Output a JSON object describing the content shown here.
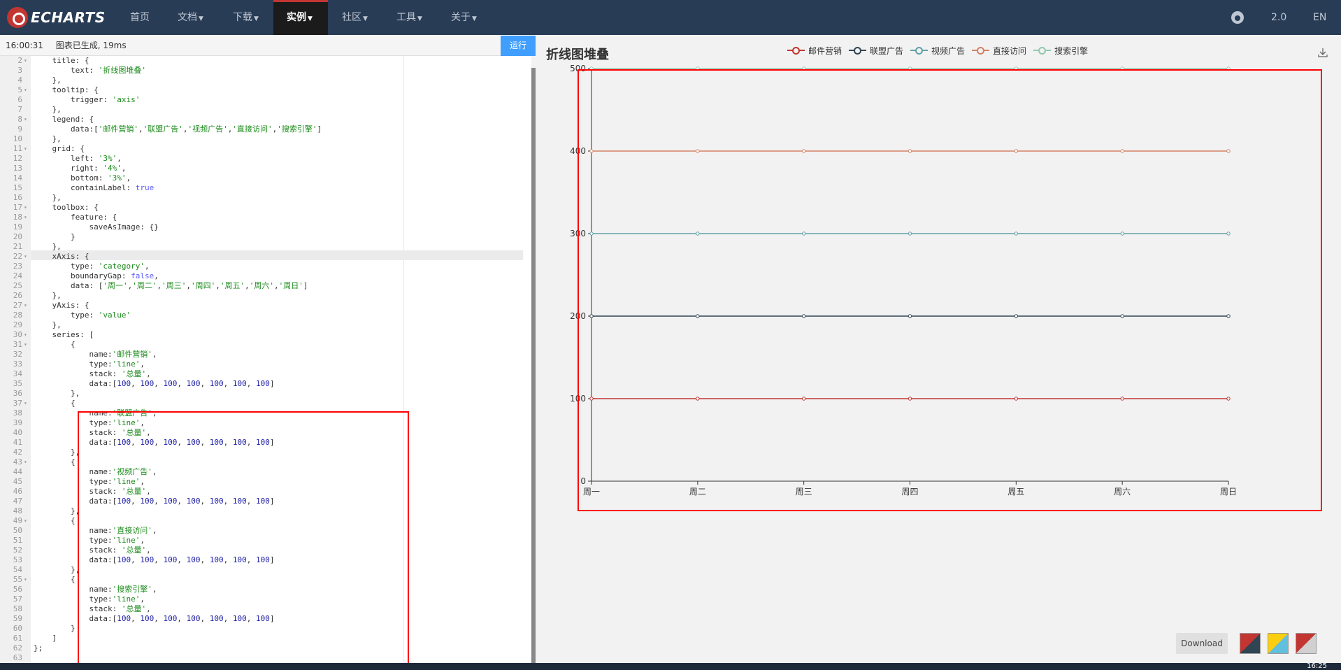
{
  "nav": {
    "logo_text": "ECHARTS",
    "items": [
      "首页",
      "文档",
      "下载",
      "实例",
      "社区",
      "工具",
      "关于"
    ],
    "version": "2.0",
    "language": "EN"
  },
  "editor": {
    "status_time": "16:00:31",
    "status_message": "图表已生成, 19ms",
    "run_label": "运行",
    "lines": [
      {
        "n": "2",
        "fold": "▾",
        "html": "    title: {"
      },
      {
        "n": "3",
        "fold": "",
        "html": "        text: <span class=\"s\">'折线图堆叠'</span>"
      },
      {
        "n": "4",
        "fold": "",
        "html": "    },"
      },
      {
        "n": "5",
        "fold": "▾",
        "html": "    tooltip: {"
      },
      {
        "n": "6",
        "fold": "",
        "html": "        trigger: <span class=\"s\">'axis'</span>"
      },
      {
        "n": "7",
        "fold": "",
        "html": "    },"
      },
      {
        "n": "8",
        "fold": "▾",
        "html": "    legend: {"
      },
      {
        "n": "9",
        "fold": "",
        "html": "        data:[<span class=\"s\">'邮件营销'</span>,<span class=\"s\">'联盟广告'</span>,<span class=\"s\">'视频广告'</span>,<span class=\"s\">'直接访问'</span>,<span class=\"s\">'搜索引擎'</span>]"
      },
      {
        "n": "10",
        "fold": "",
        "html": "    },"
      },
      {
        "n": "11",
        "fold": "▾",
        "html": "    grid: {"
      },
      {
        "n": "12",
        "fold": "",
        "html": "        left: <span class=\"s\">'3%'</span>,"
      },
      {
        "n": "13",
        "fold": "",
        "html": "        right: <span class=\"s\">'4%'</span>,"
      },
      {
        "n": "14",
        "fold": "",
        "html": "        bottom: <span class=\"s\">'3%'</span>,"
      },
      {
        "n": "15",
        "fold": "",
        "html": "        containLabel: <span class=\"b\">true</span>"
      },
      {
        "n": "16",
        "fold": "",
        "html": "    },"
      },
      {
        "n": "17",
        "fold": "▾",
        "html": "    toolbox: {"
      },
      {
        "n": "18",
        "fold": "▾",
        "html": "        feature: {"
      },
      {
        "n": "19",
        "fold": "",
        "html": "            saveAsImage: {}"
      },
      {
        "n": "20",
        "fold": "",
        "html": "        }"
      },
      {
        "n": "21",
        "fold": "",
        "html": "    },"
      },
      {
        "n": "22",
        "fold": "▾",
        "html": "    xAxis: {"
      },
      {
        "n": "23",
        "fold": "",
        "html": "        type: <span class=\"s\">'category'</span>,"
      },
      {
        "n": "24",
        "fold": "",
        "html": "        boundaryGap: <span class=\"b\">false</span>,"
      },
      {
        "n": "25",
        "fold": "",
        "html": "        data: [<span class=\"s\">'周一'</span>,<span class=\"s\">'周二'</span>,<span class=\"s\">'周三'</span>,<span class=\"s\">'周四'</span>,<span class=\"s\">'周五'</span>,<span class=\"s\">'周六'</span>,<span class=\"s\">'周日'</span>]"
      },
      {
        "n": "26",
        "fold": "",
        "html": "    },"
      },
      {
        "n": "27",
        "fold": "▾",
        "html": "    yAxis: {"
      },
      {
        "n": "28",
        "fold": "",
        "html": "        type: <span class=\"s\">'value'</span>"
      },
      {
        "n": "29",
        "fold": "",
        "html": "    },"
      },
      {
        "n": "30",
        "fold": "▾",
        "html": "    series: ["
      },
      {
        "n": "31",
        "fold": "▾",
        "html": "        {"
      },
      {
        "n": "32",
        "fold": "",
        "html": "            name:<span class=\"s\">'邮件营销'</span>,"
      },
      {
        "n": "33",
        "fold": "",
        "html": "            type:<span class=\"s\">'line'</span>,"
      },
      {
        "n": "34",
        "fold": "",
        "html": "            stack: <span class=\"s\">'总量'</span>,"
      },
      {
        "n": "35",
        "fold": "",
        "html": "            data:[<span class=\"n\">100</span>, <span class=\"n\">100</span>, <span class=\"n\">100</span>, <span class=\"n\">100</span>, <span class=\"n\">100</span>, <span class=\"n\">100</span>, <span class=\"n\">100</span>]"
      },
      {
        "n": "36",
        "fold": "",
        "html": "        },"
      },
      {
        "n": "37",
        "fold": "▾",
        "html": "        {"
      },
      {
        "n": "38",
        "fold": "",
        "html": "            name:<span class=\"s\">'联盟广告'</span>,"
      },
      {
        "n": "39",
        "fold": "",
        "html": "            type:<span class=\"s\">'line'</span>,"
      },
      {
        "n": "40",
        "fold": "",
        "html": "            stack: <span class=\"s\">'总量'</span>,"
      },
      {
        "n": "41",
        "fold": "",
        "html": "            data:[<span class=\"n\">100</span>, <span class=\"n\">100</span>, <span class=\"n\">100</span>, <span class=\"n\">100</span>, <span class=\"n\">100</span>, <span class=\"n\">100</span>, <span class=\"n\">100</span>]"
      },
      {
        "n": "42",
        "fold": "",
        "html": "        },"
      },
      {
        "n": "43",
        "fold": "▾",
        "html": "        {"
      },
      {
        "n": "44",
        "fold": "",
        "html": "            name:<span class=\"s\">'视频广告'</span>,"
      },
      {
        "n": "45",
        "fold": "",
        "html": "            type:<span class=\"s\">'line'</span>,"
      },
      {
        "n": "46",
        "fold": "",
        "html": "            stack: <span class=\"s\">'总量'</span>,"
      },
      {
        "n": "47",
        "fold": "",
        "html": "            data:[<span class=\"n\">100</span>, <span class=\"n\">100</span>, <span class=\"n\">100</span>, <span class=\"n\">100</span>, <span class=\"n\">100</span>, <span class=\"n\">100</span>, <span class=\"n\">100</span>]"
      },
      {
        "n": "48",
        "fold": "",
        "html": "        },"
      },
      {
        "n": "49",
        "fold": "▾",
        "html": "        {"
      },
      {
        "n": "50",
        "fold": "",
        "html": "            name:<span class=\"s\">'直接访问'</span>,"
      },
      {
        "n": "51",
        "fold": "",
        "html": "            type:<span class=\"s\">'line'</span>,"
      },
      {
        "n": "52",
        "fold": "",
        "html": "            stack: <span class=\"s\">'总量'</span>,"
      },
      {
        "n": "53",
        "fold": "",
        "html": "            data:[<span class=\"n\">100</span>, <span class=\"n\">100</span>, <span class=\"n\">100</span>, <span class=\"n\">100</span>, <span class=\"n\">100</span>, <span class=\"n\">100</span>, <span class=\"n\">100</span>]"
      },
      {
        "n": "54",
        "fold": "",
        "html": "        },"
      },
      {
        "n": "55",
        "fold": "▾",
        "html": "        {"
      },
      {
        "n": "56",
        "fold": "",
        "html": "            name:<span class=\"s\">'搜索引擎'</span>,"
      },
      {
        "n": "57",
        "fold": "",
        "html": "            type:<span class=\"s\">'line'</span>,"
      },
      {
        "n": "58",
        "fold": "",
        "html": "            stack: <span class=\"s\">'总量'</span>,"
      },
      {
        "n": "59",
        "fold": "",
        "html": "            data:[<span class=\"n\">100</span>, <span class=\"n\">100</span>, <span class=\"n\">100</span>, <span class=\"n\">100</span>, <span class=\"n\">100</span>, <span class=\"n\">100</span>, <span class=\"n\">100</span>]"
      },
      {
        "n": "60",
        "fold": "",
        "html": "        }"
      },
      {
        "n": "61",
        "fold": "",
        "html": "    ]"
      },
      {
        "n": "62",
        "fold": "",
        "html": "};"
      },
      {
        "n": "63",
        "fold": "",
        "html": ""
      }
    ]
  },
  "chart_panel": {
    "download_label": "Download",
    "swatch_colors": [
      [
        "#c23531",
        "#2f4554"
      ],
      [
        "#fcce10",
        "#60c0dd"
      ],
      [
        "#c23531",
        "#d0d0d0"
      ]
    ]
  },
  "chart_data": {
    "type": "line",
    "title": "折线图堆叠",
    "stacked": true,
    "categories": [
      "周一",
      "周二",
      "周三",
      "周四",
      "周五",
      "周六",
      "周日"
    ],
    "series": [
      {
        "name": "邮件营销",
        "values": [
          100,
          100,
          100,
          100,
          100,
          100,
          100
        ],
        "color": "#c23531"
      },
      {
        "name": "联盟广告",
        "values": [
          100,
          100,
          100,
          100,
          100,
          100,
          100
        ],
        "color": "#2f4554"
      },
      {
        "name": "视频广告",
        "values": [
          100,
          100,
          100,
          100,
          100,
          100,
          100
        ],
        "color": "#61a0a8"
      },
      {
        "name": "直接访问",
        "values": [
          100,
          100,
          100,
          100,
          100,
          100,
          100
        ],
        "color": "#d48265"
      },
      {
        "name": "搜索引擎",
        "values": [
          100,
          100,
          100,
          100,
          100,
          100,
          100
        ],
        "color": "#91c7ae"
      }
    ],
    "y_ticks": [
      0,
      100,
      200,
      300,
      400,
      500
    ],
    "ylim": [
      0,
      500
    ],
    "grid": false,
    "legend_position": "top-center"
  },
  "taskbar": {
    "clock": "16:25"
  }
}
